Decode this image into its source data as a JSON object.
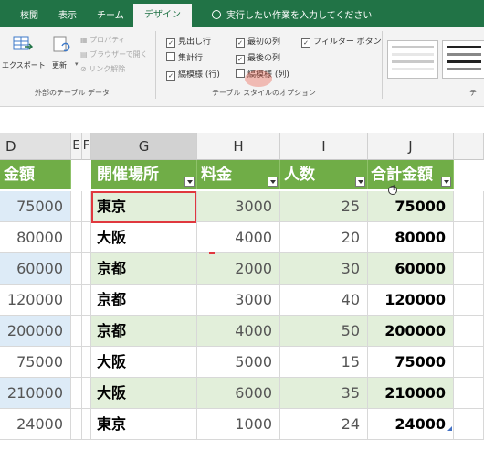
{
  "ribbon_tabs": [
    {
      "label": "校閲"
    },
    {
      "label": "表示"
    },
    {
      "label": "チーム"
    },
    {
      "label": "デザイン",
      "active": true
    }
  ],
  "tell_me": "実行したい作業を入力してください",
  "external_group": {
    "export_label": "エクスポート",
    "refresh_label": "更新",
    "properties_label": "プロパティ",
    "browser_label": "ブラウザーで開く",
    "unlink_label": "リンク解除",
    "group_label": "外部のテーブル データ"
  },
  "style_options": {
    "header_row": "見出し行",
    "first_column": "最初の列",
    "filter_button": "フィルター ボタン",
    "total_row": "集計行",
    "last_column": "最後の列",
    "banded_rows": "縞模様 (行)",
    "banded_columns": "縞模様 (列)",
    "group_label": "テーブル スタイルのオプション",
    "checked": {
      "header_row": true,
      "first_column": true,
      "filter_button": true,
      "total_row": false,
      "last_column": true,
      "banded_rows": true,
      "banded_columns": false
    }
  },
  "styles_group_label_partial": "テ",
  "column_headers": [
    "D",
    "E",
    "F",
    "G",
    "H",
    "I",
    "J"
  ],
  "table": {
    "d_header": "金額",
    "headers": [
      "開催場所",
      "料金",
      "人数",
      "合計金額"
    ],
    "d_values": [
      "75000",
      "80000",
      "60000",
      "120000",
      "200000",
      "75000",
      "210000",
      "24000"
    ],
    "rows": [
      [
        "東京",
        "3000",
        "25",
        "75000"
      ],
      [
        "大阪",
        "4000",
        "20",
        "80000"
      ],
      [
        "京都",
        "2000",
        "30",
        "60000"
      ],
      [
        "京都",
        "3000",
        "40",
        "120000"
      ],
      [
        "京都",
        "4000",
        "50",
        "200000"
      ],
      [
        "大阪",
        "5000",
        "15",
        "75000"
      ],
      [
        "大阪",
        "6000",
        "35",
        "210000"
      ],
      [
        "東京",
        "1000",
        "24",
        "24000"
      ]
    ]
  },
  "colors": {
    "ribbon_green": "#217346",
    "table_header": "#70ad47",
    "band_light": "#e2efda",
    "d_band": "#ddebf7",
    "selection_red": "#e0383e"
  }
}
